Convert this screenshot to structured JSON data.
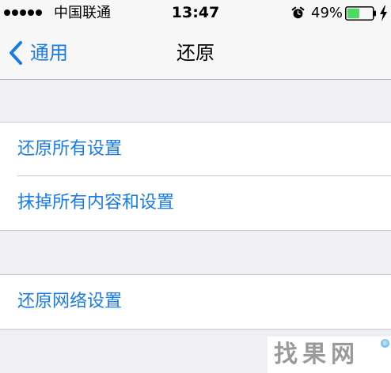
{
  "status_bar": {
    "carrier": "中国联通",
    "time": "13:47",
    "battery_percent": "49%",
    "battery_level": 0.49,
    "battery_color": "#4cd964",
    "signal_bars": 5,
    "alarm_icon": "alarm-clock-icon",
    "charge_icon": "lightning-bolt-icon"
  },
  "nav": {
    "back_label": "通用",
    "back_icon": "chevron-left-icon",
    "title": "还原"
  },
  "groups": [
    {
      "items": [
        {
          "label": "还原所有设置"
        },
        {
          "label": "抹掉所有内容和设置"
        }
      ]
    },
    {
      "items": [
        {
          "label": "还原网络设置"
        }
      ]
    }
  ],
  "watermark": {
    "text": "找果网",
    "mark": "®"
  },
  "colors": {
    "accent": "#1a7be8",
    "background": "#efeff4",
    "separator": "#c8c7cc"
  }
}
